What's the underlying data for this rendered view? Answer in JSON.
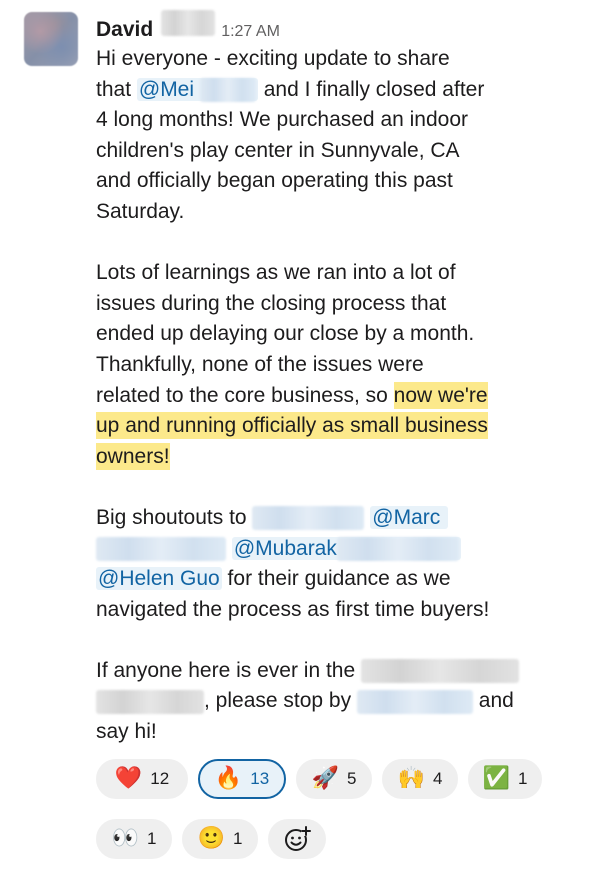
{
  "message": {
    "author": "David",
    "time": "1:27 AM",
    "p1_a": "Hi everyone - exciting update to share",
    "p1_b": "that ",
    "mention_mei": "@Mei",
    "p1_c": " and I finally closed after",
    "p1_d": "4 long months! We purchased an indoor",
    "p1_e": "children's play center in Sunnyvale, CA",
    "p1_f": "and officially began operating this past",
    "p1_g": "Saturday.",
    "p2_a": "Lots of learnings as we ran into a lot of",
    "p2_b": "issues during the closing process that",
    "p2_c": "ended up delaying our close by a month.",
    "p2_d": "Thankfully, none of the issues were",
    "p2_e": "related to the core business, so ",
    "p2_hl1": "now we're",
    "p2_hl2": "up and running officially as small business",
    "p2_hl3": "owners!",
    "p3_a": "Big shoutouts to ",
    "mention_marc": "@Marc",
    "mention_mubarak": "@Mubarak",
    "mention_helen": "@Helen Guo",
    "p3_b": " for their guidance as we",
    "p3_c": "navigated the process as first time buyers!",
    "p4_a": "If anyone here is ever in the ",
    "p4_b": ", please stop by ",
    "p4_c": " and",
    "p4_d": "say hi!"
  },
  "reactions": [
    {
      "icon": "heart-icon",
      "emoji": "❤️",
      "count": "12",
      "active": false
    },
    {
      "icon": "fire-icon",
      "emoji": "🔥",
      "count": "13",
      "active": true
    },
    {
      "icon": "rocket-icon",
      "emoji": "🚀",
      "count": "5",
      "active": false
    },
    {
      "icon": "raised-hands-icon",
      "emoji": "🙌",
      "count": "4",
      "active": false
    },
    {
      "icon": "check-mark-icon",
      "emoji": "✅",
      "count": "1",
      "active": false
    },
    {
      "icon": "eyes-icon",
      "emoji": "👀",
      "count": "1",
      "active": false
    },
    {
      "icon": "slightly-smiling-face-icon",
      "emoji": "🙂",
      "count": "1",
      "active": false
    }
  ],
  "colors": {
    "mention": "#1264a3",
    "mention_bg": "#e8f2f9",
    "highlight": "#fce98b",
    "reaction_active_border": "#1264a3"
  }
}
